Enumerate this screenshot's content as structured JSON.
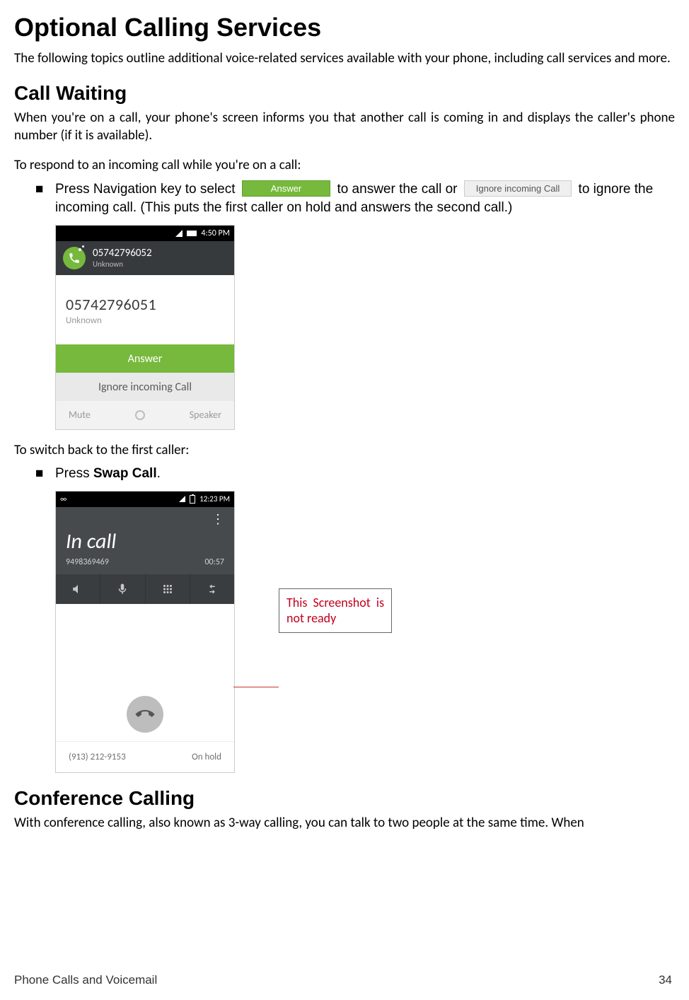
{
  "headings": {
    "h1": "Optional Calling Services",
    "h2_callwaiting": "Call Waiting",
    "h2_conference": "Conference Calling"
  },
  "paragraphs": {
    "intro": "The following topics outline additional voice-related services available with your phone, including call services and more.",
    "cw_intro": "When you're on a call, your phone's screen informs you that another call is coming in and displays the caller's phone number (if it is available).",
    "cw_respond": "To respond to an incoming call while you're on a call:",
    "cw_switch": "To switch back to the first caller:",
    "conf_intro": "With conference calling, also known as 3-way calling, you can talk to two people at the same time. When"
  },
  "bullets": {
    "press_nav_pre": "Press Navigation key to select ",
    "press_nav_mid": " to answer the call or ",
    "press_nav_post": " to ignore the incoming call. (This puts the first caller on hold and answers the second call.)",
    "swap_pre": "Press ",
    "swap_bold": "Swap Call",
    "swap_post": "."
  },
  "inline_buttons": {
    "answer": "Answer",
    "ignore": "Ignore incoming Call"
  },
  "screenshot1": {
    "status_time": "4:50 PM",
    "ongoing_number": "05742796052",
    "ongoing_sub": "Unknown",
    "incoming_number": "05742796051",
    "incoming_sub": "Unknown",
    "btn_answer": "Answer",
    "btn_ignore": "Ignore incoming Call",
    "mute": "Mute",
    "speaker": "Speaker"
  },
  "screenshot2": {
    "status_left": "∞",
    "status_time": "12:23 PM",
    "menu_dots": "⋮",
    "title": "In call",
    "active_number": "9498369469",
    "timer": "00:57",
    "hold_number": "(913) 212-9153",
    "hold_label": "On hold"
  },
  "note": "This Screenshot is not ready",
  "footer": {
    "left": "Phone Calls and Voicemail",
    "right": "34"
  },
  "colors": {
    "accent_green": "#76b93c",
    "note_red": "#c00020"
  }
}
